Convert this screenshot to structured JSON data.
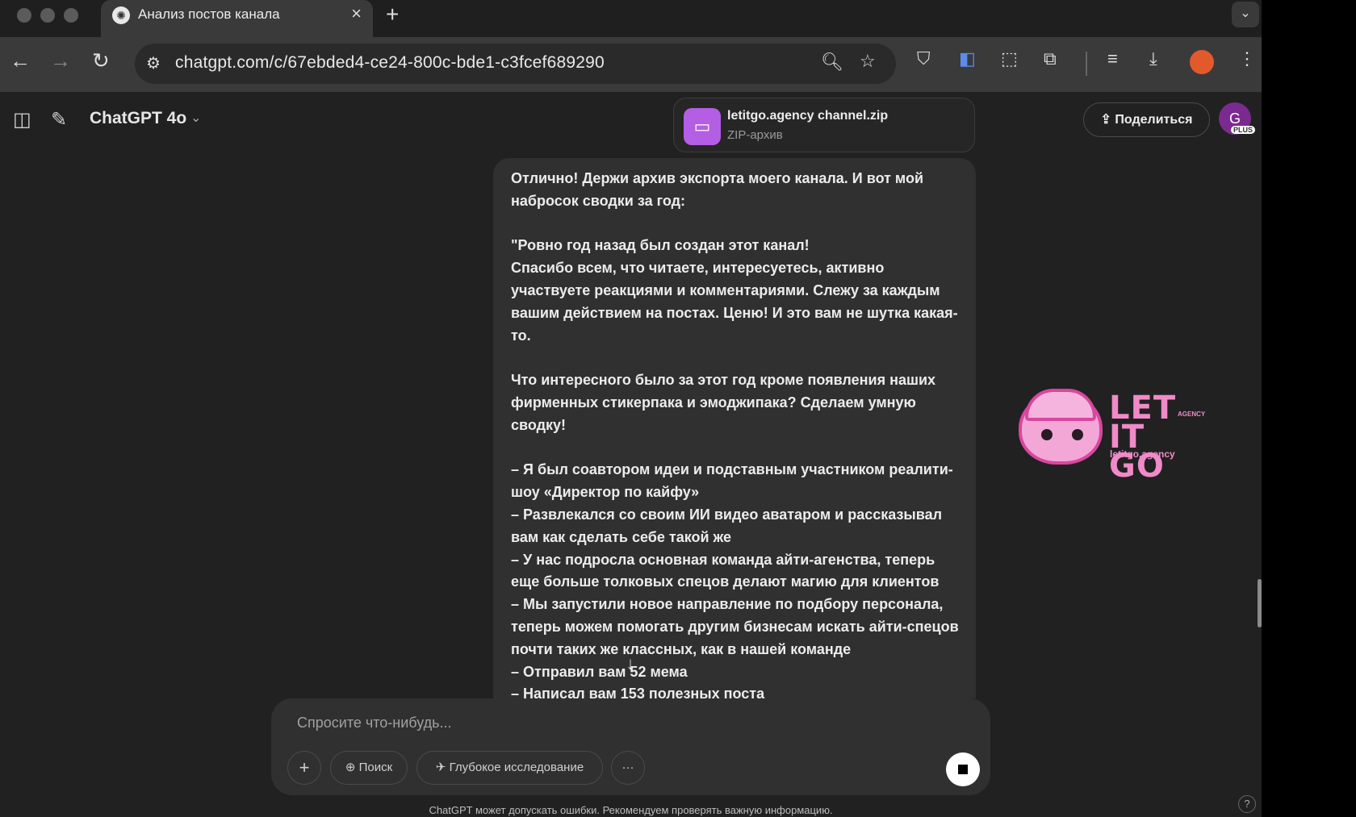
{
  "browser": {
    "tab_title": "Анализ постов канала",
    "tab_close": "×",
    "new_tab": "+",
    "tab_menu": "⌄",
    "url": "chatgpt.com/c/67ebded4-ce24-800c-bde1-c3fcef689290",
    "icons": [
      "back-icon",
      "forward-icon",
      "reload-icon",
      "site-settings-icon",
      "zoom-icon",
      "bookmark-star-icon",
      "shield-extension-icon",
      "translate-icon",
      "screenshot-icon",
      "extensions-icon",
      "media-icon",
      "download-icon",
      "profile-icon",
      "menu-icon"
    ]
  },
  "header": {
    "model": "ChatGPT 4o",
    "share_label": "Поделиться",
    "avatar_letter": "G",
    "plus_badge": "PLUS"
  },
  "attachment": {
    "name": "letitgo.agency channel.zip",
    "type": "ZIP-архив"
  },
  "message": {
    "text": "Отлично! Держи архив экспорта моего канала. И вот мой набросок сводки за год:\n\n\"Ровно год назад был создан этот канал!\nСпасибо всем, что читаете, интересуетесь, активно участвуете реакциями и комментариями. Слежу за каждым вашим действием на постах. Ценю! И это вам не шутка какая-то.\n\nЧто интересного было за этот год кроме появления наших фирменных стикерпака и эмоджипака? Сделаем умную сводку!\n\n– Я был соавтором идеи и подставным участником реалити-шоу «Директор по кайфу»\n– Развлекался со своим ИИ видео аватаром и рассказывал вам как сделать себе такой же\n– У нас подросла основная команда айти-агенства, теперь еще больше толковых спецов делают магию для клиентов\n– Мы запустили новое направление по подбору персонала, теперь можем помогать другим бизнесам искать айти-спецов почти таких же классных, как в нашей команде\n– Отправил вам 52 мема\n– Написал вам 153 полезных поста"
  },
  "composer": {
    "placeholder": "Спросите что-нибудь...",
    "add_label": "+",
    "search_label": "Поиск",
    "research_label": "Глубокое исследование",
    "more_label": "···"
  },
  "logo": {
    "line1": "LET",
    "line2": "IT GO",
    "agency": "AGENCY",
    "domain": "letitgo.agency"
  },
  "footer": {
    "disclaimer": "ChatGPT может допускать ошибки. Рекомендуем проверять важную информацию.",
    "help": "?"
  },
  "colors": {
    "background": "#212121",
    "bubble": "#303030",
    "file_icon": "#b45ee6",
    "logo_pink": "#f08ac8"
  }
}
